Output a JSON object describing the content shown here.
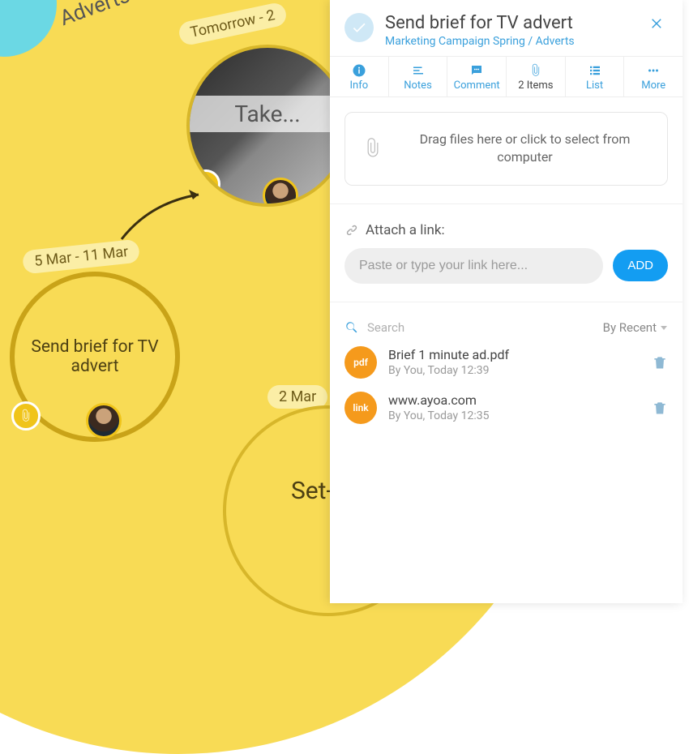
{
  "canvas": {
    "category_label": "Adverts",
    "nodes": {
      "take": {
        "date": "Tomorrow - 2",
        "title": "Take..."
      },
      "brief": {
        "date": "5 Mar - 11 Mar",
        "title": "Send brief for TV advert"
      },
      "setup": {
        "date": "2 Mar",
        "title": "Set-u..."
      }
    }
  },
  "panel": {
    "title": "Send brief for TV advert",
    "breadcrumb": "Marketing Campaign Spring / Adverts",
    "tabs": {
      "info": "Info",
      "notes": "Notes",
      "comment": "Comment",
      "items": "2 Items",
      "list": "List",
      "more": "More"
    },
    "dropzone": "Drag files here or click to select from computer",
    "attach_link_label": "Attach a link:",
    "link_placeholder": "Paste or type your link here...",
    "add_label": "ADD",
    "search_placeholder": "Search",
    "sort_label": "By Recent",
    "files": [
      {
        "badge": "pdf",
        "name": "Brief 1 minute ad.pdf",
        "sub": "By You, Today 12:39"
      },
      {
        "badge": "link",
        "name": "www.ayoa.com",
        "sub": "By You, Today 12:35"
      }
    ]
  }
}
